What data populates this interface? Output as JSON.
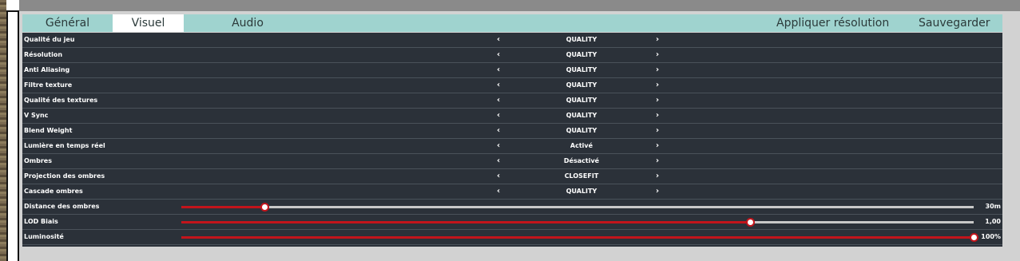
{
  "tabs": [
    {
      "label": "Général"
    },
    {
      "label": "Visuel"
    },
    {
      "label": "Audio"
    }
  ],
  "actions": {
    "apply_resolution": "Appliquer résolution",
    "save": "Sauvegarder"
  },
  "arrows": {
    "left": "‹",
    "right": "›"
  },
  "options": [
    {
      "label": "Qualité du jeu",
      "value": "QUALITY"
    },
    {
      "label": "Résolution",
      "value": "QUALITY"
    },
    {
      "label": "Anti Aliasing",
      "value": "QUALITY"
    },
    {
      "label": "Filtre texture",
      "value": "QUALITY"
    },
    {
      "label": "Qualité des textures",
      "value": "QUALITY"
    },
    {
      "label": "V Sync",
      "value": "QUALITY"
    },
    {
      "label": "Blend Weight",
      "value": "QUALITY"
    },
    {
      "label": "Lumière en temps réel",
      "value": "Activé"
    },
    {
      "label": "Ombres",
      "value": "Désactivé"
    },
    {
      "label": "Projection des ombres",
      "value": "CLOSEFIT"
    },
    {
      "label": "Cascade ombres",
      "value": "QUALITY"
    }
  ],
  "sliders": [
    {
      "label": "Distance des ombres",
      "value": "30m",
      "fraction": 0.105
    },
    {
      "label": "LOD Biais",
      "value": "1,00",
      "fraction": 0.718
    },
    {
      "label": "Luminosité",
      "value": "100%",
      "fraction": 1.0
    }
  ],
  "colors": {
    "accent": "#c2141b",
    "topbar": "#9fd3cf",
    "list_bg": "#2b3139"
  }
}
